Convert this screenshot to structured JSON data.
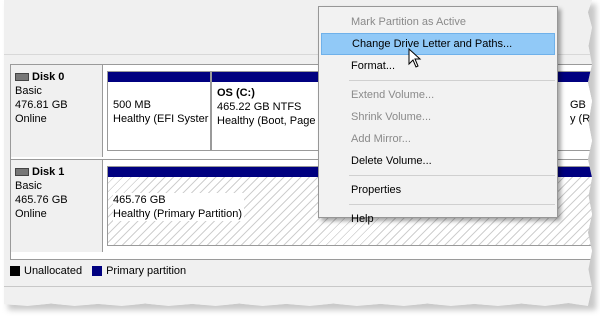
{
  "disks": [
    {
      "name": "Disk 0",
      "type": "Basic",
      "size": "476.81 GB",
      "status": "Online",
      "partitions": [
        {
          "title": "",
          "size": "500 MB",
          "health": "Healthy (EFI Syster"
        },
        {
          "title": "OS  (C:)",
          "size": "465.22 GB NTFS",
          "health": "Healthy (Boot, Page F"
        },
        {
          "title": "",
          "size": "GB",
          "health": "y (R"
        }
      ]
    },
    {
      "name": "Disk 1",
      "type": "Basic",
      "size": "465.76 GB",
      "status": "Online",
      "partitions": [
        {
          "title": "",
          "size": "465.76 GB",
          "health": "Healthy (Primary Partition)"
        }
      ]
    }
  ],
  "legend": [
    {
      "label": "Unallocated",
      "color": "#000000"
    },
    {
      "label": "Primary partition",
      "color": "#000080"
    }
  ],
  "context_menu": {
    "items": [
      {
        "label": "Mark Partition as Active",
        "disabled": true
      },
      {
        "label": "Change Drive Letter and Paths...",
        "highlighted": true
      },
      {
        "label": "Format..."
      },
      {
        "separator": true
      },
      {
        "label": "Extend Volume...",
        "disabled": true
      },
      {
        "label": "Shrink Volume...",
        "disabled": true
      },
      {
        "label": "Add Mirror...",
        "disabled": true
      },
      {
        "label": "Delete Volume..."
      },
      {
        "separator": true
      },
      {
        "label": "Properties"
      },
      {
        "separator": true
      },
      {
        "label": "Help"
      }
    ]
  },
  "colors": {
    "primary_partition": "#000080",
    "menu_highlight": "#91c9f7"
  }
}
